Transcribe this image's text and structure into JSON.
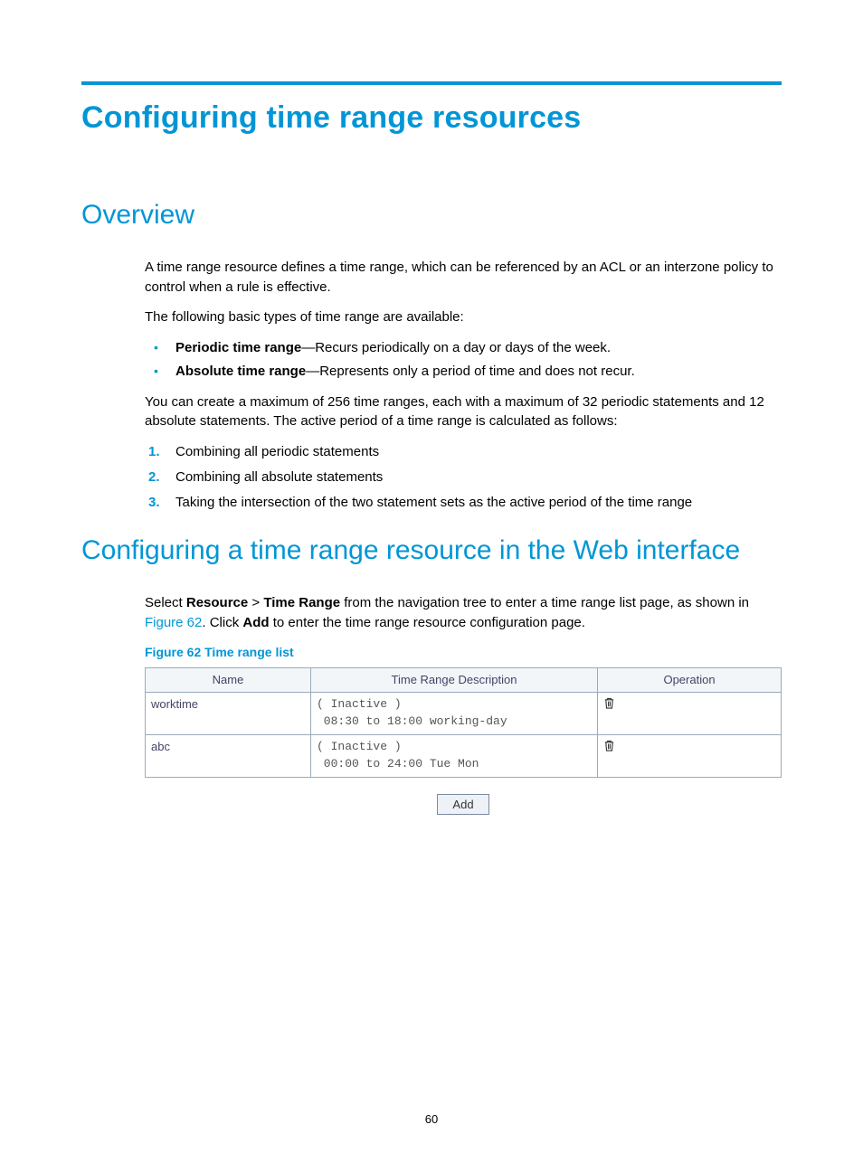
{
  "page": {
    "title": "Configuring time range resources",
    "page_number": "60"
  },
  "overview": {
    "heading": "Overview",
    "p1": "A time range resource defines a time range, which can be referenced by an ACL or an interzone policy to control when a rule is effective.",
    "p2": "The following basic types of time range are available:",
    "bullets": {
      "periodic": {
        "term": "Periodic time range",
        "desc": "—Recurs periodically on a day or days of the week."
      },
      "absolute": {
        "term": "Absolute time range",
        "desc": "—Represents only a period of time and does not recur."
      }
    },
    "p3": "You can create a maximum of 256 time ranges, each with a maximum of 32 periodic statements and 12 absolute statements. The active period of a time range is calculated as follows:",
    "steps": [
      "Combining all periodic statements",
      "Combining all absolute statements",
      "Taking the intersection of the two statement sets as the active period of the time range"
    ]
  },
  "config": {
    "heading": "Configuring a time range resource in the Web interface",
    "sentence": {
      "a": "Select ",
      "resource": "Resource",
      "gt": " > ",
      "tr": "Time Range",
      "b": " from the navigation tree to enter a time range list page, as shown in ",
      "fig_link": "Figure 62",
      "c": ". Click ",
      "add_bold": "Add",
      "d": " to enter the time range resource configuration page."
    },
    "figure_caption": "Figure 62 Time range list",
    "table": {
      "headers": {
        "name": "Name",
        "desc": "Time Range Description",
        "op": "Operation"
      },
      "rows": [
        {
          "name": "worktime",
          "desc": "( Inactive )\n 08:30 to 18:00 working-day"
        },
        {
          "name": "abc",
          "desc": "( Inactive )\n 00:00 to 24:00 Tue Mon"
        }
      ]
    },
    "add_button": "Add"
  }
}
